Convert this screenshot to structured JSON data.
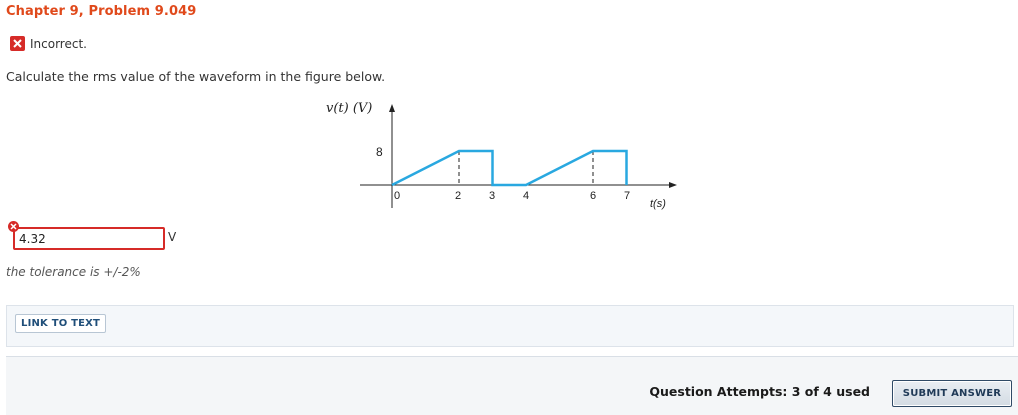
{
  "header": {
    "chapter_title": "Chapter 9, Problem 9.049"
  },
  "status": {
    "text": "Incorrect.",
    "icon": "x-icon",
    "color": "#d62b28"
  },
  "question": {
    "text": "Calculate the rms value of the waveform in the figure below."
  },
  "figure": {
    "y_axis_label": "v(t) (V)",
    "x_axis_label": "t(s)",
    "y_tick_label": "8",
    "x_tick_labels": [
      "0",
      "2",
      "3",
      "4",
      "6",
      "7"
    ],
    "line_color": "#29a8e0"
  },
  "chart_data": {
    "type": "line",
    "x": [
      0,
      2,
      3,
      3,
      4,
      6,
      7,
      7
    ],
    "y": [
      0,
      8,
      8,
      0,
      0,
      8,
      8,
      0
    ],
    "xlabel": "t(s)",
    "ylabel": "v(t) (V)",
    "xticks": [
      0,
      2,
      3,
      4,
      6,
      7
    ],
    "yticks": [
      8
    ]
  },
  "answer": {
    "value": "4.32",
    "unit": "V",
    "status_icon": "error-icon"
  },
  "tolerance": {
    "text": "the tolerance is +/-2%"
  },
  "links": {
    "link_to_text": "LINK TO TEXT"
  },
  "footer": {
    "attempts_text": "Question Attempts: 3 of 4 used",
    "submit_label": "SUBMIT ANSWER"
  }
}
